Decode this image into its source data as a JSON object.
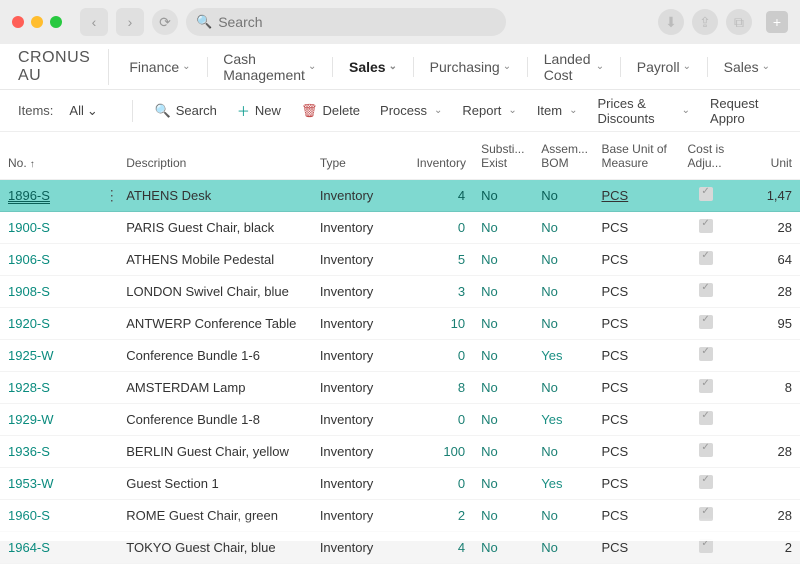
{
  "browser": {
    "search_placeholder": "Search"
  },
  "header": {
    "brand": "CRONUS AU",
    "menu": [
      "Finance",
      "Cash Management",
      "Sales",
      "Purchasing",
      "Landed Cost",
      "Payroll",
      "Sales"
    ],
    "active_index": 2
  },
  "toolbar": {
    "items_label": "Items:",
    "filter_value": "All",
    "search": "Search",
    "new": "New",
    "delete": "Delete",
    "process": "Process",
    "report": "Report",
    "item": "Item",
    "prices": "Prices & Discounts",
    "request": "Request Appro"
  },
  "table": {
    "headers": {
      "no": "No.",
      "description": "Description",
      "type": "Type",
      "inventory": "Inventory",
      "substi": "Substi... Exist",
      "assemBom": "Assem... BOM",
      "baseUom": "Base Unit of Measure",
      "costAdj": "Cost is Adju...",
      "unit": "Unit"
    },
    "rows": [
      {
        "no": "1896-S",
        "desc": "ATHENS Desk",
        "type": "Inventory",
        "inv": 4,
        "sub": "No",
        "bom": "No",
        "uom": "PCS",
        "adj": true,
        "unit": "1,47",
        "selected": true
      },
      {
        "no": "1900-S",
        "desc": "PARIS Guest Chair, black",
        "type": "Inventory",
        "inv": 0,
        "sub": "No",
        "bom": "No",
        "uom": "PCS",
        "adj": true,
        "unit": "28"
      },
      {
        "no": "1906-S",
        "desc": "ATHENS Mobile Pedestal",
        "type": "Inventory",
        "inv": 5,
        "sub": "No",
        "bom": "No",
        "uom": "PCS",
        "adj": true,
        "unit": "64"
      },
      {
        "no": "1908-S",
        "desc": "LONDON Swivel Chair, blue",
        "type": "Inventory",
        "inv": 3,
        "sub": "No",
        "bom": "No",
        "uom": "PCS",
        "adj": true,
        "unit": "28"
      },
      {
        "no": "1920-S",
        "desc": "ANTWERP Conference Table",
        "type": "Inventory",
        "inv": 10,
        "sub": "No",
        "bom": "No",
        "uom": "PCS",
        "adj": true,
        "unit": "95"
      },
      {
        "no": "1925-W",
        "desc": "Conference Bundle 1-6",
        "type": "Inventory",
        "inv": 0,
        "sub": "No",
        "bom": "Yes",
        "uom": "PCS",
        "adj": true,
        "unit": ""
      },
      {
        "no": "1928-S",
        "desc": "AMSTERDAM Lamp",
        "type": "Inventory",
        "inv": 8,
        "sub": "No",
        "bom": "No",
        "uom": "PCS",
        "adj": true,
        "unit": "8"
      },
      {
        "no": "1929-W",
        "desc": "Conference Bundle 1-8",
        "type": "Inventory",
        "inv": 0,
        "sub": "No",
        "bom": "Yes",
        "uom": "PCS",
        "adj": true,
        "unit": ""
      },
      {
        "no": "1936-S",
        "desc": "BERLIN Guest Chair, yellow",
        "type": "Inventory",
        "inv": 100,
        "sub": "No",
        "bom": "No",
        "uom": "PCS",
        "adj": true,
        "unit": "28"
      },
      {
        "no": "1953-W",
        "desc": "Guest Section 1",
        "type": "Inventory",
        "inv": 0,
        "sub": "No",
        "bom": "Yes",
        "uom": "PCS",
        "adj": true,
        "unit": ""
      },
      {
        "no": "1960-S",
        "desc": "ROME Guest Chair, green",
        "type": "Inventory",
        "inv": 2,
        "sub": "No",
        "bom": "No",
        "uom": "PCS",
        "adj": true,
        "unit": "28"
      },
      {
        "no": "1964-S",
        "desc": "TOKYO Guest Chair, blue",
        "type": "Inventory",
        "inv": 4,
        "sub": "No",
        "bom": "No",
        "uom": "PCS",
        "adj": true,
        "unit": "2"
      }
    ]
  }
}
